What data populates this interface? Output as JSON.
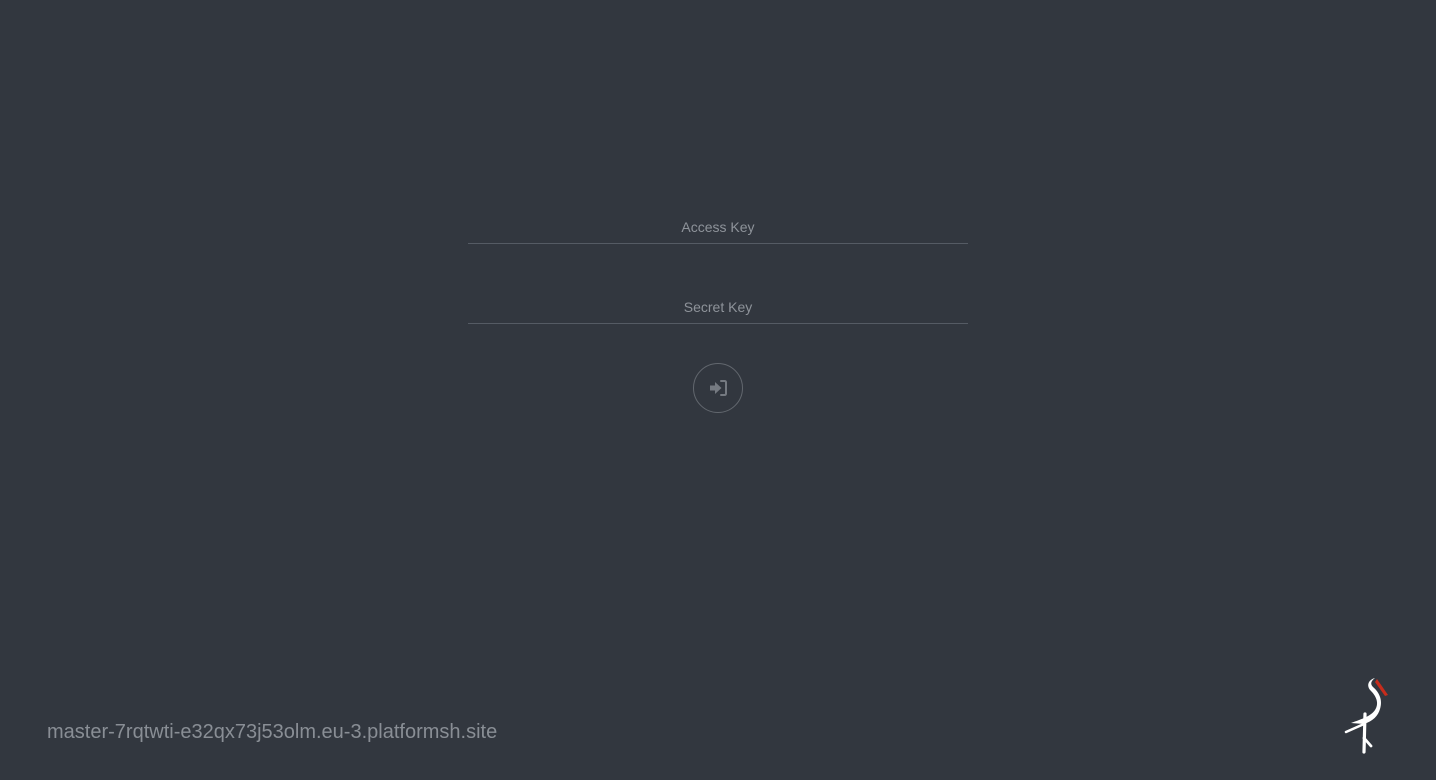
{
  "login": {
    "access_key_placeholder": "Access Key",
    "secret_key_placeholder": "Secret Key",
    "access_key_value": "",
    "secret_key_value": ""
  },
  "footer": {
    "host": "master-7rqtwti-e32qx73j53olm.eu-3.platformsh.site"
  },
  "icons": {
    "login": "sign-in-icon",
    "logo": "stork-logo-icon"
  },
  "colors": {
    "background": "#32373f",
    "logo_accent": "#c72c1c"
  }
}
